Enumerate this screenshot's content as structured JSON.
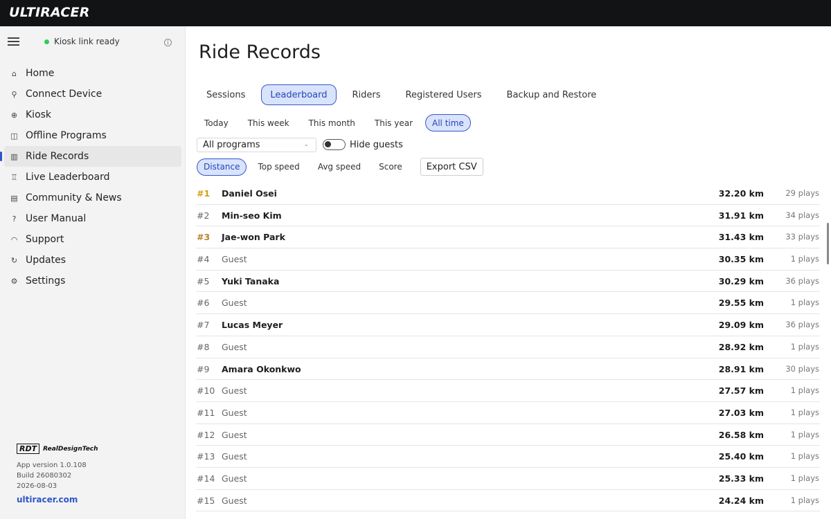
{
  "app": {
    "logo": "ULTIRACER"
  },
  "sidebar": {
    "status_text": "Kiosk link ready",
    "status_color": "#2ecc5b",
    "items": [
      {
        "label": "Home",
        "icon": "home-icon",
        "glyph": "⌂"
      },
      {
        "label": "Connect Device",
        "icon": "antenna-icon",
        "glyph": "⚲"
      },
      {
        "label": "Kiosk",
        "icon": "globe-icon",
        "glyph": "⊕"
      },
      {
        "label": "Offline Programs",
        "icon": "gamepad-icon",
        "glyph": "◫"
      },
      {
        "label": "Ride Records",
        "icon": "bar-chart-icon",
        "glyph": "▥",
        "active": true
      },
      {
        "label": "Live Leaderboard",
        "icon": "trophy-icon",
        "glyph": "♖"
      },
      {
        "label": "Community & News",
        "icon": "newspaper-icon",
        "glyph": "▤"
      },
      {
        "label": "User Manual",
        "icon": "question-icon",
        "glyph": "?"
      },
      {
        "label": "Support",
        "icon": "headset-icon",
        "glyph": "◠"
      },
      {
        "label": "Updates",
        "icon": "refresh-icon",
        "glyph": "↻"
      },
      {
        "label": "Settings",
        "icon": "gear-icon",
        "glyph": "⚙"
      }
    ],
    "brand_box": "RDT",
    "brand_name": "RealDesignTech",
    "app_version": "App version 1.0.108",
    "build": "Build 26080302",
    "date": "2026-08-03",
    "site": "ultiracer.com",
    "accent": "#2f55c8"
  },
  "main": {
    "title": "Ride Records",
    "tabs": [
      "Sessions",
      "Leaderboard",
      "Riders",
      "Registered Users",
      "Backup and Restore"
    ],
    "active_tab": "Leaderboard",
    "ranges": [
      "Today",
      "This week",
      "This month",
      "This year",
      "All time"
    ],
    "active_range": "All time",
    "program_select": "All programs",
    "hide_guests_label": "Hide guests",
    "hide_guests_on": false,
    "metrics": [
      "Distance",
      "Top speed",
      "Avg speed",
      "Score"
    ],
    "active_metric": "Distance",
    "export_label": "Export CSV"
  },
  "leaderboard": [
    {
      "rank": "#1",
      "name": "Daniel Osei",
      "guest": false,
      "distance": "32.20 km",
      "plays": "29 plays",
      "medal": "gold"
    },
    {
      "rank": "#2",
      "name": "Min-seo Kim",
      "guest": false,
      "distance": "31.91 km",
      "plays": "34 plays",
      "medal": "silver"
    },
    {
      "rank": "#3",
      "name": "Jae-won Park",
      "guest": false,
      "distance": "31.43 km",
      "plays": "33 plays",
      "medal": "bronze"
    },
    {
      "rank": "#4",
      "name": "Guest",
      "guest": true,
      "distance": "30.35 km",
      "plays": "1 plays"
    },
    {
      "rank": "#5",
      "name": "Yuki Tanaka",
      "guest": false,
      "distance": "30.29 km",
      "plays": "36 plays"
    },
    {
      "rank": "#6",
      "name": "Guest",
      "guest": true,
      "distance": "29.55 km",
      "plays": "1 plays"
    },
    {
      "rank": "#7",
      "name": "Lucas Meyer",
      "guest": false,
      "distance": "29.09 km",
      "plays": "36 plays"
    },
    {
      "rank": "#8",
      "name": "Guest",
      "guest": true,
      "distance": "28.92 km",
      "plays": "1 plays"
    },
    {
      "rank": "#9",
      "name": "Amara Okonkwo",
      "guest": false,
      "distance": "28.91 km",
      "plays": "30 plays"
    },
    {
      "rank": "#10",
      "name": "Guest",
      "guest": true,
      "distance": "27.57 km",
      "plays": "1 plays"
    },
    {
      "rank": "#11",
      "name": "Guest",
      "guest": true,
      "distance": "27.03 km",
      "plays": "1 plays"
    },
    {
      "rank": "#12",
      "name": "Guest",
      "guest": true,
      "distance": "26.58 km",
      "plays": "1 plays"
    },
    {
      "rank": "#13",
      "name": "Guest",
      "guest": true,
      "distance": "25.40 km",
      "plays": "1 plays"
    },
    {
      "rank": "#14",
      "name": "Guest",
      "guest": true,
      "distance": "25.33 km",
      "plays": "1 plays"
    },
    {
      "rank": "#15",
      "name": "Guest",
      "guest": true,
      "distance": "24.24 km",
      "plays": "1 plays"
    }
  ]
}
